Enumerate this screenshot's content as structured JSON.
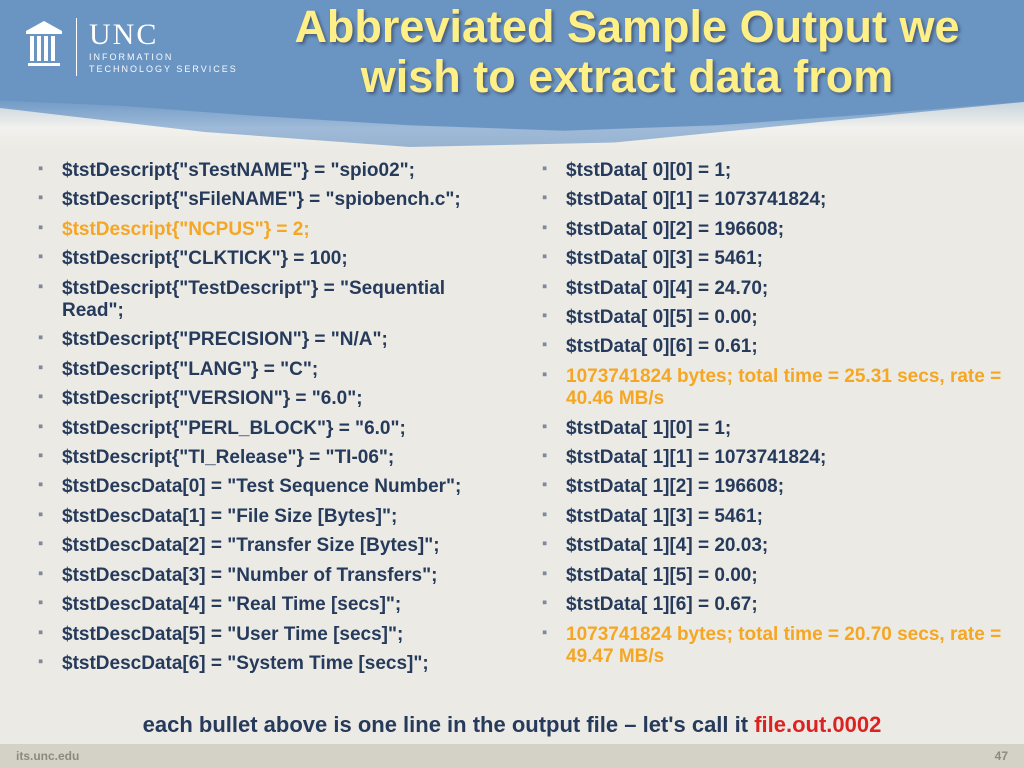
{
  "logo": {
    "brand": "UNC",
    "line1": "INFORMATION",
    "line2": "TECHNOLOGY SERVICES"
  },
  "title": "Abbreviated Sample Output we wish to extract data from",
  "left": [
    {
      "t": "$tstDescript{\"sTestNAME\"}    = \"spio02\";",
      "hi": false
    },
    {
      "t": "$tstDescript{\"sFileNAME\"}    = \"spiobench.c\";",
      "hi": false
    },
    {
      "t": "$tstDescript{\"NCPUS\"}        = 2;",
      "hi": true
    },
    {
      "t": "$tstDescript{\"CLKTICK\"}      = 100;",
      "hi": false
    },
    {
      "t": "$tstDescript{\"TestDescript\"} = \"Sequential Read\";",
      "hi": false
    },
    {
      "t": "$tstDescript{\"PRECISION\"}    = \"N/A\";",
      "hi": false
    },
    {
      "t": "$tstDescript{\"LANG\"}         = \"C\";",
      "hi": false
    },
    {
      "t": "$tstDescript{\"VERSION\"}      = \"6.0\";",
      "hi": false
    },
    {
      "t": "$tstDescript{\"PERL_BLOCK\"}   = \"6.0\";",
      "hi": false
    },
    {
      "t": "$tstDescript{\"TI_Release\"}   = \"TI-06\";",
      "hi": false
    },
    {
      "t": "$tstDescData[0] = \"Test Sequence Number\";",
      "hi": false
    },
    {
      "t": "$tstDescData[1] = \"File Size [Bytes]\";",
      "hi": false
    },
    {
      "t": "$tstDescData[2] = \"Transfer Size [Bytes]\";",
      "hi": false
    },
    {
      "t": "$tstDescData[3] = \"Number of Transfers\";",
      "hi": false
    },
    {
      "t": "$tstDescData[4] = \"Real Time [secs]\";",
      "hi": false
    },
    {
      "t": "$tstDescData[5] = \"User Time [secs]\";",
      "hi": false
    },
    {
      "t": "$tstDescData[6] = \"System Time [secs]\";",
      "hi": false
    }
  ],
  "right": [
    {
      "t": "$tstData[   0][0] = 1;",
      "hi": false
    },
    {
      "t": "$tstData[   0][1] = 1073741824;",
      "hi": false
    },
    {
      "t": "$tstData[   0][2] = 196608;",
      "hi": false
    },
    {
      "t": "$tstData[   0][3] = 5461;",
      "hi": false
    },
    {
      "t": "$tstData[   0][4] = 24.70;",
      "hi": false
    },
    {
      "t": "$tstData[   0][5] = 0.00;",
      "hi": false
    },
    {
      "t": "$tstData[   0][6] = 0.61;",
      "hi": false
    },
    {
      "t": "1073741824 bytes; total time = 25.31 secs, rate = 40.46 MB/s",
      "hi": true
    },
    {
      "t": "$tstData[   1][0] = 1;",
      "hi": false
    },
    {
      "t": "$tstData[   1][1] = 1073741824;",
      "hi": false
    },
    {
      "t": "$tstData[   1][2] = 196608;",
      "hi": false
    },
    {
      "t": "$tstData[   1][3] = 5461;",
      "hi": false
    },
    {
      "t": "$tstData[   1][4] = 20.03;",
      "hi": false
    },
    {
      "t": "$tstData[   1][5] = 0.00;",
      "hi": false
    },
    {
      "t": "$tstData[   1][6] = 0.67;",
      "hi": false
    },
    {
      "t": "1073741824 bytes; total time = 20.70 secs, rate = 49.47 MB/s",
      "hi": true
    }
  ],
  "caption": {
    "text": "each bullet above is one line in the output file – let's call it ",
    "file": "file.out.0002"
  },
  "footer": {
    "left": "its.unc.edu",
    "right": "47"
  }
}
